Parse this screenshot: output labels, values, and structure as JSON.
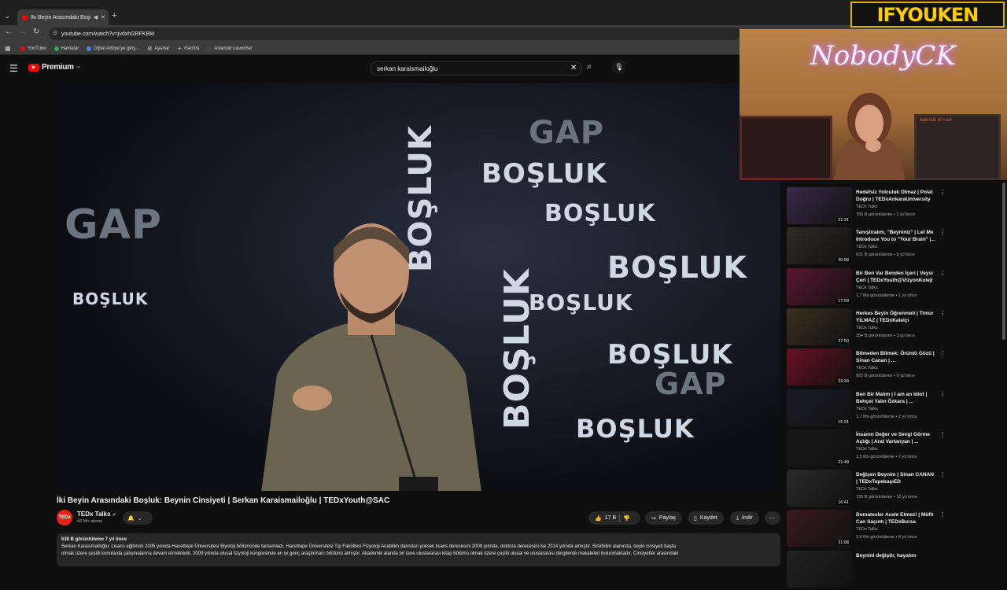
{
  "browser": {
    "tab_title": "İki Beyin Arasındaki Boşluk:",
    "url": "youtube.com/watch?v=jvdxhGRFKBM",
    "bookmarks": [
      "YouTube",
      "Haritalar",
      "Dijital Atölye'ye giriş...",
      "Ayarlar",
      "Gemini",
      "Asteroid Launcher"
    ]
  },
  "youtube": {
    "logo": "Premium",
    "logo_badge": "TR",
    "search_value": "serkan karaismailoğlu"
  },
  "player": {
    "background_words": [
      "BOŞLUK",
      "GAP"
    ]
  },
  "video": {
    "title": "İki Beyin Arasındaki Boşluk: Beynin Cinsiyeti | Serkan Karaismailoğlu | TEDxYouth@SAC",
    "channel": "TEDx Talks",
    "channel_avatar": "TEDx",
    "subscribers": "44 Mn abone",
    "likes": "17 B",
    "share": "Paylaş",
    "save": "Kaydet",
    "download": "İndir",
    "views_line": "538 B görüntüleme  7 yıl önce",
    "description_line1": "Serkan Karaismailoğlu: Lisans eğitimini 2005 yılında Hacettepe Üniversitesi Biyoloji bölümünde tamamladı. Hacettepe Üniversitesi Tıp Fakültesi Fizyoloji Anabilim dalından yüksek lisans derecesini 2009 yılında, doktora derecesini ise 2014 yılında almıştır. Sinirbilim alanında, beyin cinsiyeti başta",
    "description_line2": "olmak üzere çeşitli konularda çalışmalarına devam etmektedir. 2009 yılında ulusal fizyoloji kongresinde en iyi genç araştırmacı ödülünü almıştır. Akademik alanda bir tane uluslararası kitap bölümü olmak üzere çeşitli ulusal ve uluslararası dergilerde makaleleri bulunmaktadır. Cinsiyetler arasındaki"
  },
  "webcam": {
    "brand": "IFYOUKEN",
    "neon": "NobodyCK",
    "poster_text": "legends of rock"
  },
  "recommendations": [
    {
      "title": "Hedefsiz Yolculuk Olmaz | Polat Doğru | TEDxAnkaraUniversity",
      "channel": "TEDx Talks",
      "meta": "795 B görüntüleme • 1 yıl önce",
      "duration": "21:31",
      "thumb_color": "#3a2a4a"
    },
    {
      "title": "Tanıştıralım, \"Beyniniz\" | Let Me Introduce You to \"Your Brain\" |...",
      "channel": "TEDx Talks",
      "meta": "631 B görüntüleme • 9 yıl önce",
      "duration": "20:58",
      "thumb_color": "#2e2a26"
    },
    {
      "title": "Bir Ben Var Benden İçeri | Veysi Çeri | TEDxYouth@VizyonKoleji",
      "channel": "TEDx Talks",
      "meta": "1,7 Mn görüntüleme • 1 yıl önce",
      "duration": "17:03",
      "thumb_color": "#5a1630"
    },
    {
      "title": "Herkes Beyin Öğrenmeli | Timur YILMAZ | TEDxKaleiçi",
      "channel": "TEDx Talks",
      "meta": "254 B görüntüleme • 3 yıl önce",
      "duration": "27:50",
      "thumb_color": "#3a3020"
    },
    {
      "title": "Bilmeden Bilmek: Örüntü Gözü | Sinan Canan | ...",
      "channel": "TEDx Talks",
      "meta": "922 B görüntüleme • 9 yıl önce",
      "duration": "23:34",
      "thumb_color": "#6a1020"
    },
    {
      "title": "Ben Bir Malım | I am an Idiot | Behçet Yalın Özkara | ...",
      "channel": "TEDx Talks",
      "meta": "1,7 Mn görüntüleme • 2 yıl önce",
      "duration": "15:31",
      "thumb_color": "#1c1c2a"
    },
    {
      "title": "İnsanın Değer ve Sevgi Görme Açlığı | Arat Vartanyan | ...",
      "channel": "TEDx Talks",
      "meta": "1,5 Mn görüntüleme • 7 yıl önce",
      "duration": "21:49",
      "thumb_color": "#181818"
    },
    {
      "title": "Değişen Beynim | Sinan CANAN | TEDxTepebaşıED",
      "channel": "TEDx Talks",
      "meta": "735 B görüntüleme • 10 yıl önce",
      "duration": "16:41",
      "thumb_color": "#2a2a2a"
    },
    {
      "title": "Domatesler Acele Etmez! | Müfit Can Saçıntı | TEDxBursa",
      "channel": "TEDx Talks",
      "meta": "2,4 Mn görüntüleme • 8 yıl önce",
      "duration": "21:08",
      "thumb_color": "#3a1a1a"
    },
    {
      "title": "Beynini değiştir, hayatını",
      "channel": "",
      "meta": "",
      "duration": "",
      "thumb_color": "#222222"
    }
  ]
}
